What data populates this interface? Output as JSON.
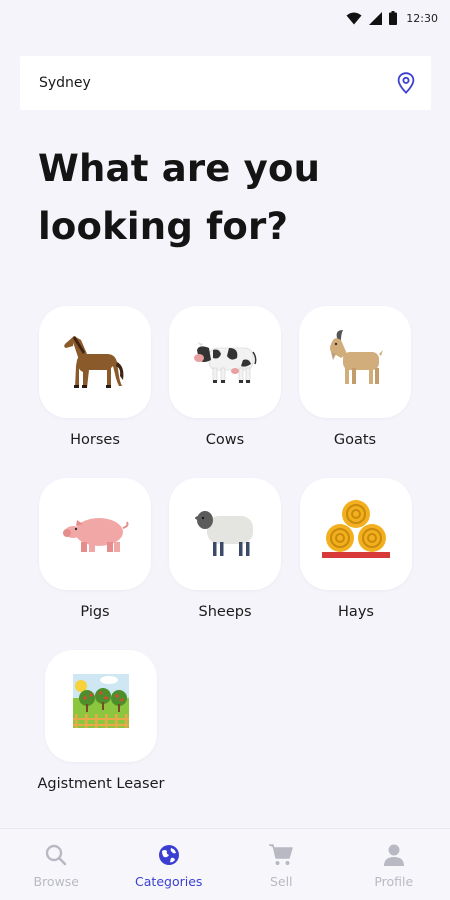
{
  "status_bar": {
    "time": "12:30",
    "icons": [
      "wifi-icon",
      "signal-icon",
      "battery-icon"
    ]
  },
  "location": {
    "value": "Sydney",
    "icon": "location-pin-icon"
  },
  "headline": "What are you looking for?",
  "categories": [
    {
      "label": "Horses",
      "icon": "horse-icon"
    },
    {
      "label": "Cows",
      "icon": "cow-icon"
    },
    {
      "label": "Goats",
      "icon": "goat-icon"
    },
    {
      "label": "Pigs",
      "icon": "pig-icon"
    },
    {
      "label": "Sheeps",
      "icon": "sheep-icon"
    },
    {
      "label": "Hays",
      "icon": "hay-bales-icon"
    },
    {
      "label": "Agistment Leaser",
      "icon": "orchard-field-icon"
    }
  ],
  "bottom_nav": {
    "active": "Categories",
    "items": [
      {
        "label": "Browse",
        "icon": "search-icon"
      },
      {
        "label": "Categories",
        "icon": "globe-icon"
      },
      {
        "label": "Sell",
        "icon": "cart-icon"
      },
      {
        "label": "Profile",
        "icon": "user-icon"
      }
    ]
  },
  "colors": {
    "background": "#f4f4fa",
    "accent": "#3b3fd1",
    "inactive_nav": "#b9b9c4",
    "tile": "#ffffff"
  }
}
